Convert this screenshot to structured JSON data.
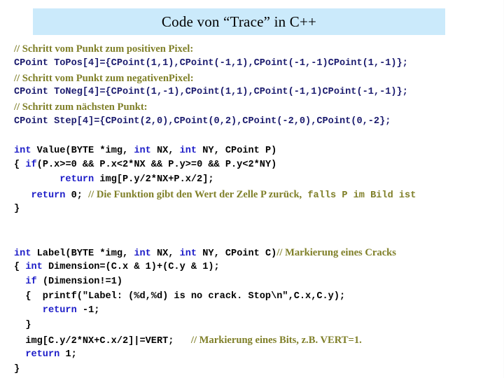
{
  "slide": {
    "title": "Code von “Trace” in C++",
    "title_bg": "#cbeafb",
    "background": "#ffffff",
    "colors": {
      "comment_green": "#7f7f28",
      "keyword_blue": "#1c1cc8",
      "navy": "#1b1b6e",
      "black": "#000000"
    }
  },
  "code": {
    "lines": [
      {
        "id": "line-1",
        "kind": "comment",
        "spans": [
          {
            "cls": "cm",
            "text": "// Schritt vom Punkt zum positiven Pixel:"
          }
        ]
      },
      {
        "id": "line-2",
        "kind": "code",
        "spans": [
          {
            "cls": "nv",
            "text": "CPoint ToPos[4]={CPoint(1,1),CPoint(-1,1),CPoint(-1,-1)CPoint(1,-1)};"
          }
        ]
      },
      {
        "id": "line-3",
        "kind": "comment",
        "spans": [
          {
            "cls": "cm",
            "text": "// Schritt vom Punkt zum negativenPixel:"
          }
        ]
      },
      {
        "id": "line-4",
        "kind": "code",
        "spans": [
          {
            "cls": "nv",
            "text": "CPoint ToNeg[4]={CPoint(1,-1),CPoint(1,1),CPoint(-1,1)CPoint(-1,-1)};"
          }
        ]
      },
      {
        "id": "line-5",
        "kind": "comment",
        "spans": [
          {
            "cls": "cm",
            "text": "// Schritt zum nächsten Punkt:"
          }
        ]
      },
      {
        "id": "line-6",
        "kind": "code",
        "spans": [
          {
            "cls": "nv",
            "text": "CPoint Step[4]={CPoint(2,0),CPoint(0,2),CPoint(-2,0),CPoint(0,-2};"
          }
        ]
      },
      {
        "id": "line-7",
        "kind": "blank",
        "spans": []
      },
      {
        "id": "line-8",
        "kind": "code",
        "spans": [
          {
            "cls": "kw",
            "text": "int"
          },
          {
            "cls": "bk",
            "text": " Value(BYTE *img, "
          },
          {
            "cls": "kw",
            "text": "int"
          },
          {
            "cls": "bk",
            "text": " NX, "
          },
          {
            "cls": "kw",
            "text": "int"
          },
          {
            "cls": "bk",
            "text": " NY, CPoint P)"
          }
        ]
      },
      {
        "id": "line-9",
        "kind": "code",
        "spans": [
          {
            "cls": "bk",
            "text": "{ "
          },
          {
            "cls": "kw",
            "text": "if"
          },
          {
            "cls": "bk",
            "text": "(P.x>=0 && P.x<2*NX && P.y>=0 && P.y<2*NY)"
          }
        ]
      },
      {
        "id": "line-10",
        "kind": "code",
        "spans": [
          {
            "cls": "bk",
            "text": "        "
          },
          {
            "cls": "kw",
            "text": "return"
          },
          {
            "cls": "bk",
            "text": " img[P.y/2*NX+P.x/2];"
          }
        ]
      },
      {
        "id": "line-11",
        "kind": "code",
        "spans": [
          {
            "cls": "bk",
            "text": "   "
          },
          {
            "cls": "kw",
            "text": "return"
          },
          {
            "cls": "bk",
            "text": " 0; "
          },
          {
            "cls": "cm",
            "text": "// Die Funktion gibt den Wert der Zelle P zurück,"
          },
          {
            "cls": "cm-mono",
            "text": " falls P im Bild ist"
          }
        ]
      },
      {
        "id": "line-12",
        "kind": "code",
        "spans": [
          {
            "cls": "bk",
            "text": "}"
          }
        ]
      },
      {
        "id": "line-13",
        "kind": "blank",
        "spans": []
      },
      {
        "id": "line-14",
        "kind": "blank",
        "spans": []
      },
      {
        "id": "line-15",
        "kind": "code",
        "spans": [
          {
            "cls": "kw",
            "text": "int"
          },
          {
            "cls": "bk",
            "text": " Label(BYTE *img, "
          },
          {
            "cls": "kw",
            "text": "int"
          },
          {
            "cls": "bk",
            "text": " NX, "
          },
          {
            "cls": "kw",
            "text": "int"
          },
          {
            "cls": "bk",
            "text": " NY, CPoint C)"
          },
          {
            "cls": "cm",
            "text": "// Markierung eines Cracks"
          }
        ]
      },
      {
        "id": "line-16",
        "kind": "code",
        "spans": [
          {
            "cls": "bk",
            "text": "{ "
          },
          {
            "cls": "kw",
            "text": "int"
          },
          {
            "cls": "bk",
            "text": " Dimension=(C.x & 1)+(C.y & 1);"
          }
        ]
      },
      {
        "id": "line-17",
        "kind": "code",
        "spans": [
          {
            "cls": "bk",
            "text": "  "
          },
          {
            "cls": "kw",
            "text": "if"
          },
          {
            "cls": "bk",
            "text": " (Dimension!=1)"
          }
        ]
      },
      {
        "id": "line-18",
        "kind": "code",
        "spans": [
          {
            "cls": "bk",
            "text": "  {  printf(\"Label: (%d,%d) is no crack. Stop\\n\",C.x,C.y);"
          }
        ]
      },
      {
        "id": "line-19",
        "kind": "code",
        "spans": [
          {
            "cls": "bk",
            "text": "     "
          },
          {
            "cls": "kw",
            "text": "return"
          },
          {
            "cls": "bk",
            "text": " -1;"
          }
        ]
      },
      {
        "id": "line-20",
        "kind": "code",
        "spans": [
          {
            "cls": "bk",
            "text": "  }"
          }
        ]
      },
      {
        "id": "line-21",
        "kind": "code",
        "spans": [
          {
            "cls": "bk",
            "text": "  img[C.y/2*NX+C.x/2]|=VERT;   "
          },
          {
            "cls": "cm",
            "text": "// Markierung eines Bits, z.B. VERT=1."
          }
        ]
      },
      {
        "id": "line-22",
        "kind": "code",
        "spans": [
          {
            "cls": "bk",
            "text": "  "
          },
          {
            "cls": "kw",
            "text": "return"
          },
          {
            "cls": "bk",
            "text": " 1;"
          }
        ]
      },
      {
        "id": "line-23",
        "kind": "code",
        "spans": [
          {
            "cls": "bk",
            "text": "}"
          }
        ]
      }
    ]
  }
}
